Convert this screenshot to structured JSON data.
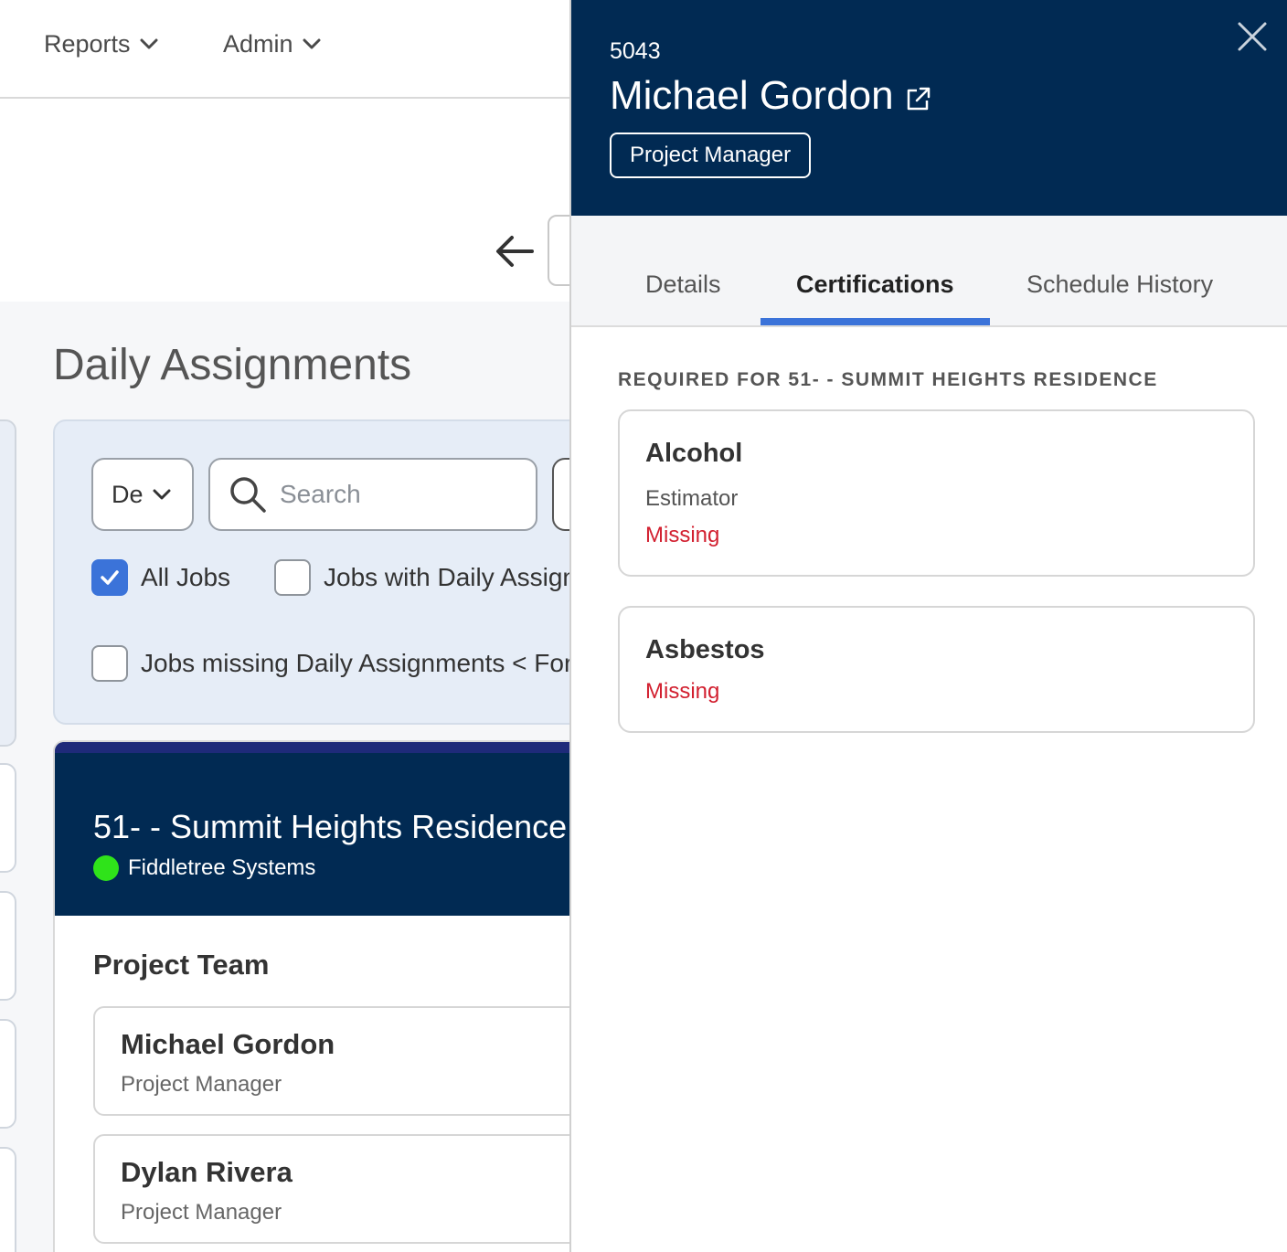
{
  "nav": {
    "reports_label": "Reports",
    "admin_label": "Admin"
  },
  "page": {
    "title": "Daily Assignments"
  },
  "filters": {
    "select_value": "De",
    "search_placeholder": "Search",
    "all_jobs_label": "All Jobs",
    "all_jobs_checked": true,
    "jobs_with_label": "Jobs with Daily Assign",
    "jobs_missing_label": "Jobs missing Daily Assignments < For"
  },
  "job": {
    "title": "51- - Summit Heights Residence",
    "company": "Fiddletree Systems",
    "status_color": "#2fe31a",
    "team_title": "Project Team",
    "members": [
      {
        "name": "Michael Gordon",
        "role": "Project Manager"
      },
      {
        "name": "Dylan Rivera",
        "role": "Project Manager"
      }
    ]
  },
  "drawer": {
    "employee_id": "5043",
    "employee_name": "Michael Gordon",
    "role": "Project Manager",
    "tabs": [
      {
        "label": "Details",
        "active": false
      },
      {
        "label": "Certifications",
        "active": true
      },
      {
        "label": "Schedule History",
        "active": false
      }
    ],
    "required_for_label": "REQUIRED FOR 51- - SUMMIT HEIGHTS RESIDENCE",
    "certifications": [
      {
        "name": "Alcohol",
        "role": "Estimator",
        "status": "Missing"
      },
      {
        "name": "Asbestos",
        "status": "Missing"
      }
    ]
  },
  "colors": {
    "navy": "#012a53",
    "accent_blue": "#3b73d9",
    "missing_red": "#d21f2f"
  }
}
